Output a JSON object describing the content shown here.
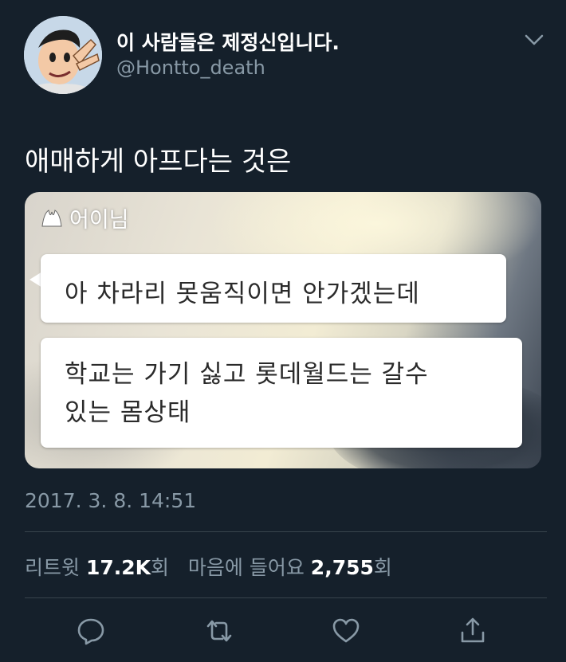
{
  "author": {
    "display_name": "이 사람들은 제정신입니다.",
    "handle": "@Hontto_death",
    "avatar_icon": "cartoon-avatar"
  },
  "tweet": {
    "text": "애매하게 아프다는 것은",
    "timestamp": "2017. 3. 8. 14:51"
  },
  "media": {
    "sender_name": "어이님",
    "messages": [
      "아 차라리 못움직이면 안가겠는데",
      "학교는 가기 싫고 롯데월드는 갈수",
      "있는 몸상태"
    ]
  },
  "stats": {
    "retweets_label": "리트윗",
    "retweets_count": "17.2K",
    "retweets_unit": "회",
    "likes_label": "마음에 들어요",
    "likes_count": "2,755",
    "likes_unit": "회"
  },
  "colors": {
    "background": "#15202b",
    "muted_text": "#8899a6",
    "divider": "#38444d"
  },
  "action_icons": [
    "reply-icon",
    "retweet-icon",
    "like-icon",
    "share-icon"
  ]
}
